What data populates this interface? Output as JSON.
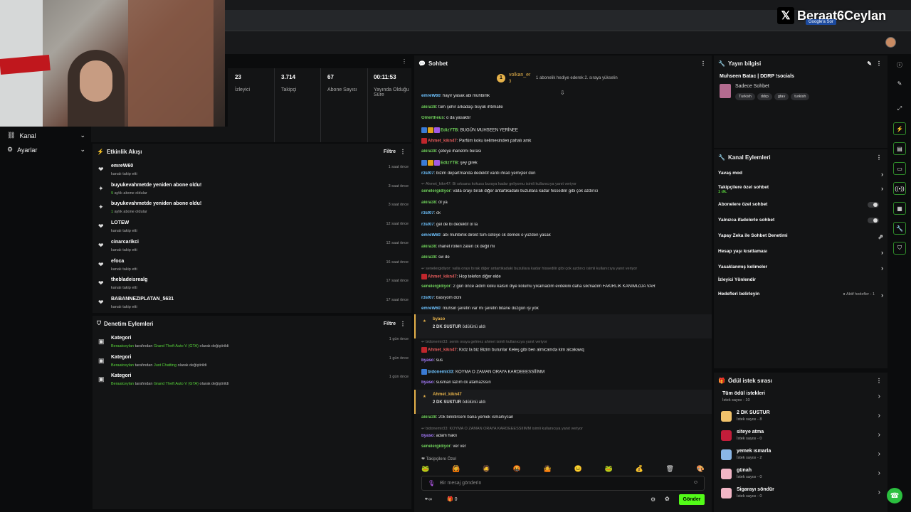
{
  "watermark": {
    "x_glyph": "𝕏",
    "handle": "Beraat6Ceylan",
    "badge": "Google'a Sor"
  },
  "nav": [
    {
      "label": "Kanal",
      "icon": "channel-icon"
    },
    {
      "label": "Ayarlar",
      "icon": "gear-icon"
    }
  ],
  "stats": [
    {
      "value": "23",
      "label": "İzleyici"
    },
    {
      "value": "3.714",
      "label": "Takipçi"
    },
    {
      "value": "67",
      "label": "Abone Sayısı"
    },
    {
      "value": "00:11:53",
      "label": "Yayında Olduğu Süre"
    }
  ],
  "activity": {
    "title": "Etkinlik Akışı",
    "filter": "Filtre",
    "menu": "⋮",
    "items": [
      {
        "name": "emreW60",
        "sub": "kanalı takip etti",
        "sub_hl": "",
        "time": "1 saat önce",
        "icon": "heart"
      },
      {
        "name": "buyukevahmetde yeniden abone oldu!",
        "sub": " aylık abone oldular",
        "sub_hl": "9",
        "time": "3 saat önce",
        "icon": "star"
      },
      {
        "name": "buyukevahmetde yeniden abone oldu!",
        "sub": " aylık abone oldular",
        "sub_hl": "1",
        "time": "3 saat önce",
        "icon": "star"
      },
      {
        "name": "LOTEW",
        "sub": "kanalı takip etti",
        "sub_hl": "",
        "time": "12 saat önce",
        "icon": "heart"
      },
      {
        "name": "cinarcarikci",
        "sub": "kanalı takip etti",
        "sub_hl": "",
        "time": "12 saat önce",
        "icon": "heart"
      },
      {
        "name": "efoca",
        "sub": "kanalı takip etti",
        "sub_hl": "",
        "time": "16 saat önce",
        "icon": "heart"
      },
      {
        "name": "thebladeisrealg",
        "sub": "kanalı takip etti",
        "sub_hl": "",
        "time": "17 saat önce",
        "icon": "heart"
      },
      {
        "name": "BABANNEZIPLATAN_5631",
        "sub": "kanalı takip etti",
        "sub_hl": "",
        "time": "17 saat önce",
        "icon": "heart"
      }
    ]
  },
  "moderation": {
    "title": "Denetim Eylemleri",
    "filter": "Filtre",
    "menu": "⋮",
    "items": [
      {
        "name": "Kategori",
        "who": "Beraatceylan",
        "mid": " tarafından ",
        "cat": "Grand Theft Auto V (GTA)",
        "end": " olarak değiştirildi",
        "time": "1 gün önce"
      },
      {
        "name": "Kategori",
        "who": "Beraatceylan",
        "mid": " tarafından ",
        "cat": "Just Chatting",
        "end": " olarak değiştirildi",
        "time": "1 gün önce"
      },
      {
        "name": "Kategori",
        "who": "Beraatceylan",
        "mid": " tarafından ",
        "cat": "Grand Theft Auto V (GTA)",
        "end": " olarak değiştirildi",
        "time": "1 gün önce"
      }
    ]
  },
  "chat": {
    "title": "Sohbet",
    "menu": "⋮",
    "pinned": {
      "rank": "1",
      "user": "volkan_er",
      "count": "3",
      "text": "1 abonelik hediye ederek 2. sıraya yükselin"
    },
    "messages": [
      {
        "user": "emreW60",
        "text": " hayır yasak abi muhbirlik",
        "cls": "u4",
        "reply": ""
      },
      {
        "user": "akira38",
        "text": " tüm şehir arkadaşı büyük ihtimalle",
        "cls": "u1",
        "reply": ""
      },
      {
        "user": "Omertheus",
        "text": " o da yasaktır",
        "cls": "u1",
        "reply": ""
      },
      {
        "user": "EdizYTB",
        "text": " BUGÜN MUHSEEN YERİNEE",
        "cls": "u1",
        "reply": "",
        "badges": [
          "#3a7bd5",
          "#e0a21b",
          "#a15ae6"
        ]
      },
      {
        "user": "Ahmet_kikn47",
        "text": " Parfüm koku kelimesinden pahalı amk",
        "cls": "u3",
        "reply": "",
        "badges": [
          "#c0262c"
        ]
      },
      {
        "user": "akira38",
        "text": " çeteye ihanetmi burası",
        "cls": "u1",
        "reply": ""
      },
      {
        "user": "EdizYTB",
        "text": " şey girek",
        "cls": "u1",
        "reply": "",
        "badges": [
          "#3a7bd5",
          "#e0a21b",
          "#a15ae6"
        ]
      },
      {
        "user": "r3st07",
        "text": " bizim departmanda dedektif vardı ihraö yemişler dün",
        "cls": "u4",
        "reply": ""
      },
      {
        "user": "senelergidiyor",
        "text": " valla orayı bırak diğer antartikadaki buzullara kadar hissedilir gibi çok azdırıcı",
        "cls": "u1",
        "reply": "Ahmet_kikn47: Bi sıksana kokusu buraya kadar geliyomu isimli kullanıcıya yanıt veriyor"
      },
      {
        "user": "akira38",
        "text": " öl ya",
        "cls": "u1",
        "reply": ""
      },
      {
        "user": "r3st07",
        "text": " ck",
        "cls": "u4",
        "reply": ""
      },
      {
        "user": "r3st07",
        "text": " gel de bi dedektif ol la",
        "cls": "u4",
        "reply": ""
      },
      {
        "user": "emreW60",
        "text": " abi muhbirlik direkt tüm ceteye ck demek o yüzden yasak",
        "cls": "u4",
        "reply": ""
      },
      {
        "user": "akira38",
        "text": " ihanet rolleri zaten ck değil mi",
        "cls": "u1",
        "reply": ""
      },
      {
        "user": "akira38",
        "text": " sw de",
        "cls": "u1",
        "reply": ""
      },
      {
        "user": "Ahmet_kikn47",
        "text": " Hop telefon diğer elde",
        "cls": "u3",
        "reply": "senelergidiyor: valla orayı bırak diğer antartikadaki buzullara kadar hissedilir gibi çok azdırıcı isimli kullanıcıya yanıt veriyor",
        "badges": [
          "#c0262c"
        ]
      },
      {
        "user": "senelergidiyor",
        "text": " 2 gün önce aldım koku kalsın diye kolumu yıkamadım evdekini daha sıkmadım FAKİRLİK KANIMIZDA VAR",
        "cls": "u1",
        "reply": ""
      },
      {
        "user": "r3st07",
        "text": " basıyom dcni",
        "cls": "u4",
        "reply": ""
      },
      {
        "user": "emreW60",
        "text": " muhsin şerefin var mı şerefin bitane düzgün işi yok",
        "cls": "u4",
        "reply": ""
      }
    ],
    "redeem1": {
      "user": "byaso",
      "reward": "2 DK SUSTUR",
      "tail": " ödülünü aldı"
    },
    "messages2": [
      {
        "user": "Ahmet_kikn47",
        "text": " Krdz la biz Bizim burunlar Keleş gibi ben almicamda kim alcakawq",
        "cls": "u3",
        "reply": "bidonemir33: senin oraya gelmez ahmet isimli kullanıcıya yanıt veriyor",
        "badges": [
          "#c0262c"
        ]
      },
      {
        "user": "byaso",
        "text": " sus",
        "cls": "u2",
        "reply": ""
      },
      {
        "user": "bidonemir33",
        "text": " KOYMA O ZAMAN ORAYA KARDEEESSİİİMM",
        "cls": "u4",
        "reply": "",
        "badges": [
          "#3a7bd5"
        ]
      },
      {
        "user": "byaso",
        "text": " susman lazım ck atamazssın",
        "cls": "u2",
        "reply": ""
      }
    ],
    "redeem2": {
      "user": "Ahmet_kikn47",
      "reward": "2 DK SUSTUR",
      "tail": " ödülünü aldı"
    },
    "messages3": [
      {
        "user": "akira38",
        "text": " 20k biriktircem bana yemek ısmarlıycan",
        "cls": "u1",
        "reply": ""
      },
      {
        "user": "byaso",
        "text": " adam haklı",
        "cls": "u2",
        "reply": "bidonemir33: KOYMA O ZAMAN ORAYA KARDEEESSİİİMM isimli kullanıcıya yanıt veriyor"
      },
      {
        "user": "senelergidiyor",
        "text": " ver ver",
        "cls": "u1",
        "reply": ""
      }
    ],
    "followers_only": "Takipçilere Özel",
    "emojis": [
      "🐸",
      "🙆",
      "🧔",
      "🤬",
      "🤷",
      "😐",
      "🐸",
      "💰",
      "🗑",
      "🎨"
    ],
    "placeholder": "Bir mesaj gönderin",
    "points": "∞",
    "gifts": "0",
    "send": "Gönder"
  },
  "stream_info": {
    "title": "Yayın bilgisi",
    "stream_title": "Muhseen Batac | DDRP !socials",
    "category": "Sadece Sohbet",
    "tags": [
      "Turkish",
      "ddrp",
      "gtav",
      "turkish"
    ]
  },
  "channel_actions": {
    "title": "Kanal Eylemleri",
    "rows": [
      {
        "label": "Yavaş mod",
        "type": "chev",
        "sub": ""
      },
      {
        "label": "Takipçilere özel sohbet",
        "type": "chev",
        "sub": "1 dk."
      },
      {
        "label": "Abonelere özel sohbet",
        "type": "toggle",
        "sub": ""
      },
      {
        "label": "Yalnızca ifadelerle sohbet",
        "type": "toggle",
        "sub": ""
      },
      {
        "label": "Yapay Zeka ile Sohbet Denetimi",
        "type": "ext",
        "sub": ""
      },
      {
        "label": "Hesap yaşı kısıtlaması",
        "type": "chev",
        "sub": ""
      },
      {
        "label": "Yasaklanmış kelimeler",
        "type": "chev",
        "sub": ""
      },
      {
        "label": "İzleyici Yönlendir",
        "type": "none",
        "sub": ""
      },
      {
        "label": "Hedefleri belirleyin",
        "type": "goal",
        "sub": "Aktif hedefler - 1"
      }
    ]
  },
  "rewards": {
    "title": "Ödül istek sırası",
    "items": [
      {
        "label": "Tüm ödül istekleri",
        "sub": "İstek sayısı - 10",
        "color": ""
      },
      {
        "label": "2 DK SUSTUR",
        "sub": "İstek sayısı - 8",
        "color": "#f2c36b"
      },
      {
        "label": "siteye atma",
        "sub": "İstek sayısı - 0",
        "color": "#c21d3a"
      },
      {
        "label": "yemek ısmarla",
        "sub": "İstek sayısı - 2",
        "color": "#8ab6e6"
      },
      {
        "label": "günah",
        "sub": "İstek sayısı - 0",
        "color": "#f2b6c6"
      },
      {
        "label": "Sigarayı söndür",
        "sub": "İstek sayısı - 0",
        "color": "#f2b6c6"
      }
    ]
  }
}
